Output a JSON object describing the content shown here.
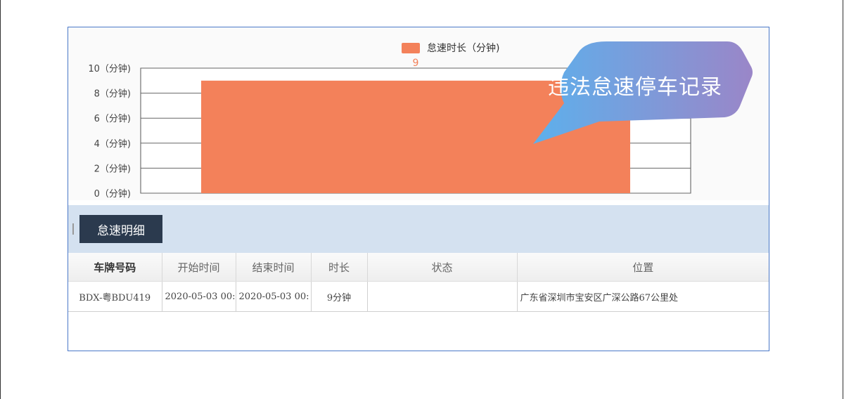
{
  "chart_data": {
    "type": "bar",
    "categories": [
      ""
    ],
    "series": [
      {
        "name": "怠速时长（分钟)",
        "values": [
          9
        ]
      }
    ],
    "data_labels": [
      "9"
    ],
    "ylim": [
      0,
      10
    ],
    "yticks": [
      {
        "value": 0,
        "label": "0（分钟)"
      },
      {
        "value": 2,
        "label": "2（分钟)"
      },
      {
        "value": 4,
        "label": "4（分钟)"
      },
      {
        "value": 6,
        "label": "6（分钟)"
      },
      {
        "value": 8,
        "label": "8（分钟)"
      },
      {
        "value": 10,
        "label": "10（分钟)"
      }
    ],
    "legend_position": "top",
    "grid": true,
    "bar_color": "#f3815a"
  },
  "legend": {
    "label": "怠速时长（分钟)"
  },
  "banner": {
    "title": "违法怠速停车记录"
  },
  "section": {
    "button_label": "怠速明细"
  },
  "table": {
    "headers": [
      "车牌号码",
      "开始时间",
      "结束时间",
      "时长",
      "状态",
      "位置"
    ],
    "rows": [
      {
        "plate": "BDX-粤BDU419",
        "start": "2020-05-03  00:",
        "end": "2020-05-03  00:",
        "duration": "9分钟",
        "status": "",
        "location": "广东省深圳市宝安区广深公路67公里处"
      }
    ]
  },
  "colors": {
    "accent_bar": "#f3815a",
    "section_bg": "#d4e1f0",
    "button_bg": "#2b3a4e",
    "panel_border": "#4a78c8"
  }
}
